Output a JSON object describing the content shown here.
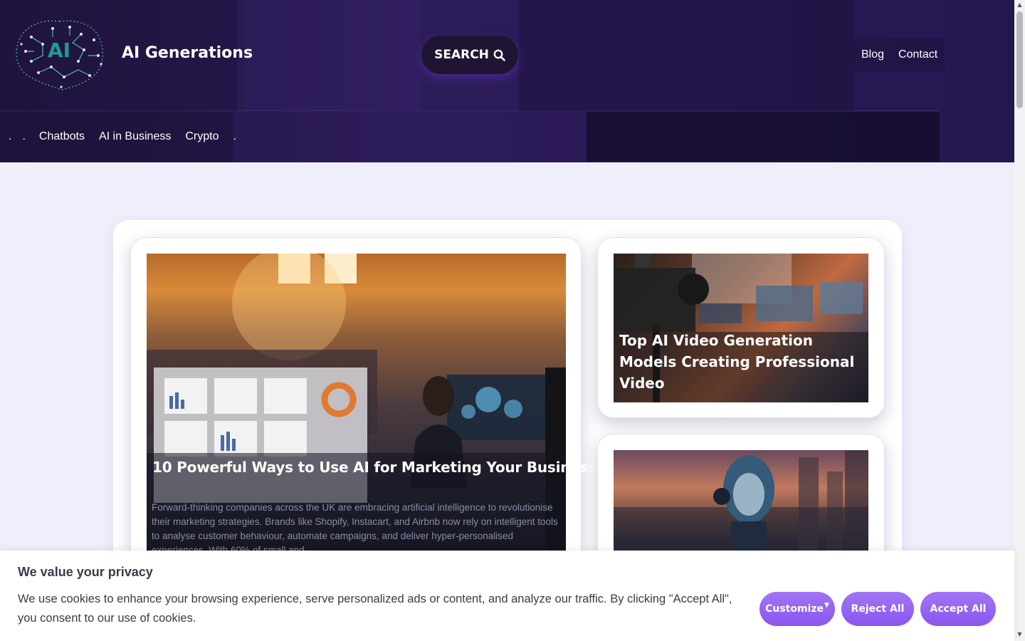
{
  "header": {
    "site_name": "AI Generations",
    "search_label": "SEARCH",
    "top_nav": [
      "Blog",
      "Contact"
    ],
    "sub_nav": {
      "dots_before": [
        ".",
        "."
      ],
      "items": [
        "Chatbots",
        "AI in Business",
        "Crypto"
      ],
      "dot_after": "."
    }
  },
  "articles": {
    "featured": {
      "title": "10 Powerful Ways to Use AI for Marketing Your Business",
      "excerpt": "Forward-thinking companies across the UK are embracing artificial intelligence to revolutionise their marketing strategies. Brands like Shopify, Instacart, and Airbnb now rely on intelligent tools to analyse customer behaviour, automate campaigns, and deliver hyper-personalised experiences. With 60% of small and"
    },
    "side_1": {
      "title": "Top AI Video Generation Models Creating Professional Video"
    }
  },
  "cookie": {
    "title": "We value your privacy",
    "text": "We use cookies to enhance your browsing experience, serve personalized ads or content, and analyze our traffic. By clicking \"Accept All\", you consent to our use of cookies.",
    "customize_label": "Customize",
    "reject_label": "Reject All",
    "accept_label": "Accept All"
  },
  "colors": {
    "header_bg": "#2d1c5a",
    "accent": "#8a56ee",
    "page_bg": "#f1eefc"
  }
}
